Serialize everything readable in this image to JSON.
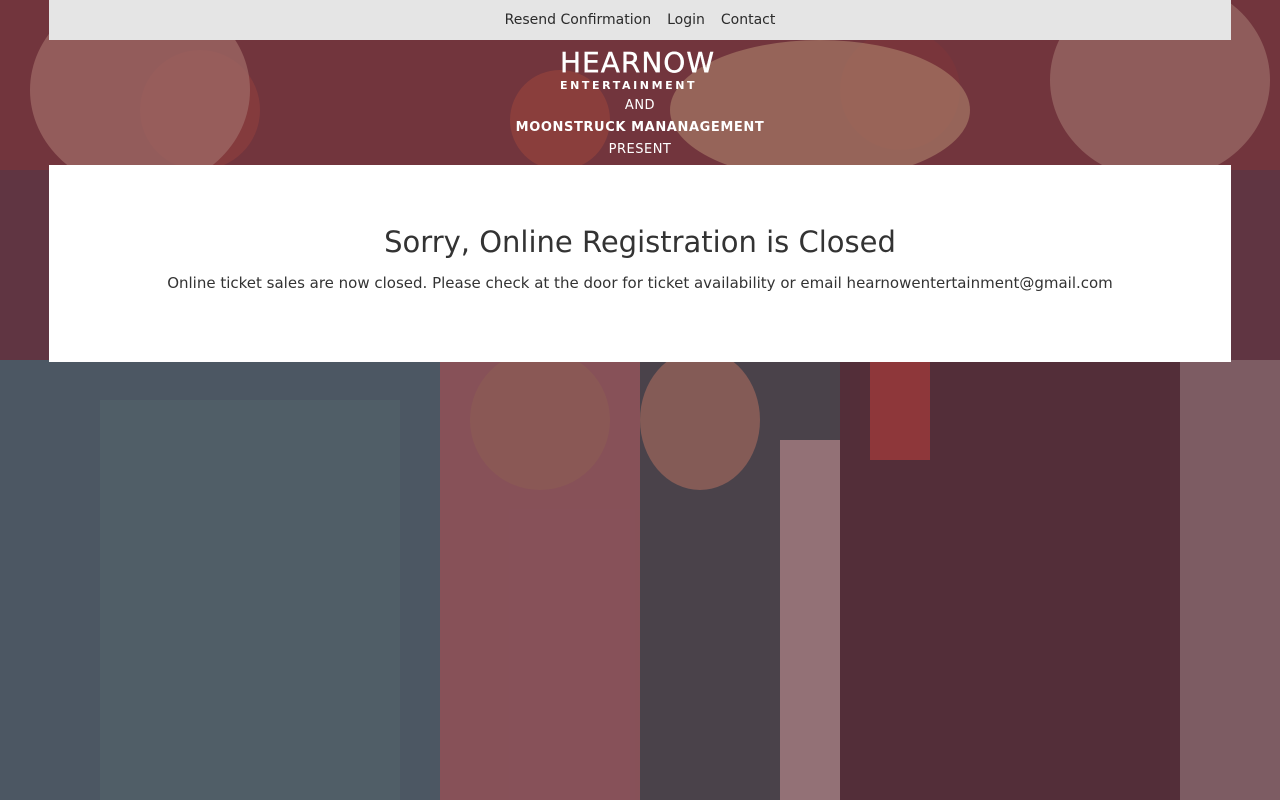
{
  "nav": {
    "items": [
      {
        "label": "Resend Confirmation"
      },
      {
        "label": "Login"
      },
      {
        "label": "Contact"
      }
    ]
  },
  "brand": {
    "logo_primary": "HEARNOW",
    "logo_secondary": "ENTERTAINMENT",
    "and_text": "AND",
    "management": "MOONSTRUCK MANANAGEMENT",
    "present": "PRESENT"
  },
  "notice": {
    "title": "Sorry, Online Registration is Closed",
    "message": "Online ticket sales are now closed. Please check at the door for ticket availability or email hearnowentertainment@gmail.com"
  },
  "colors": {
    "nav_bg": "#e5e5e5",
    "card_bg": "#ffffff",
    "text": "#333333",
    "overlay": "#5a3a44"
  }
}
